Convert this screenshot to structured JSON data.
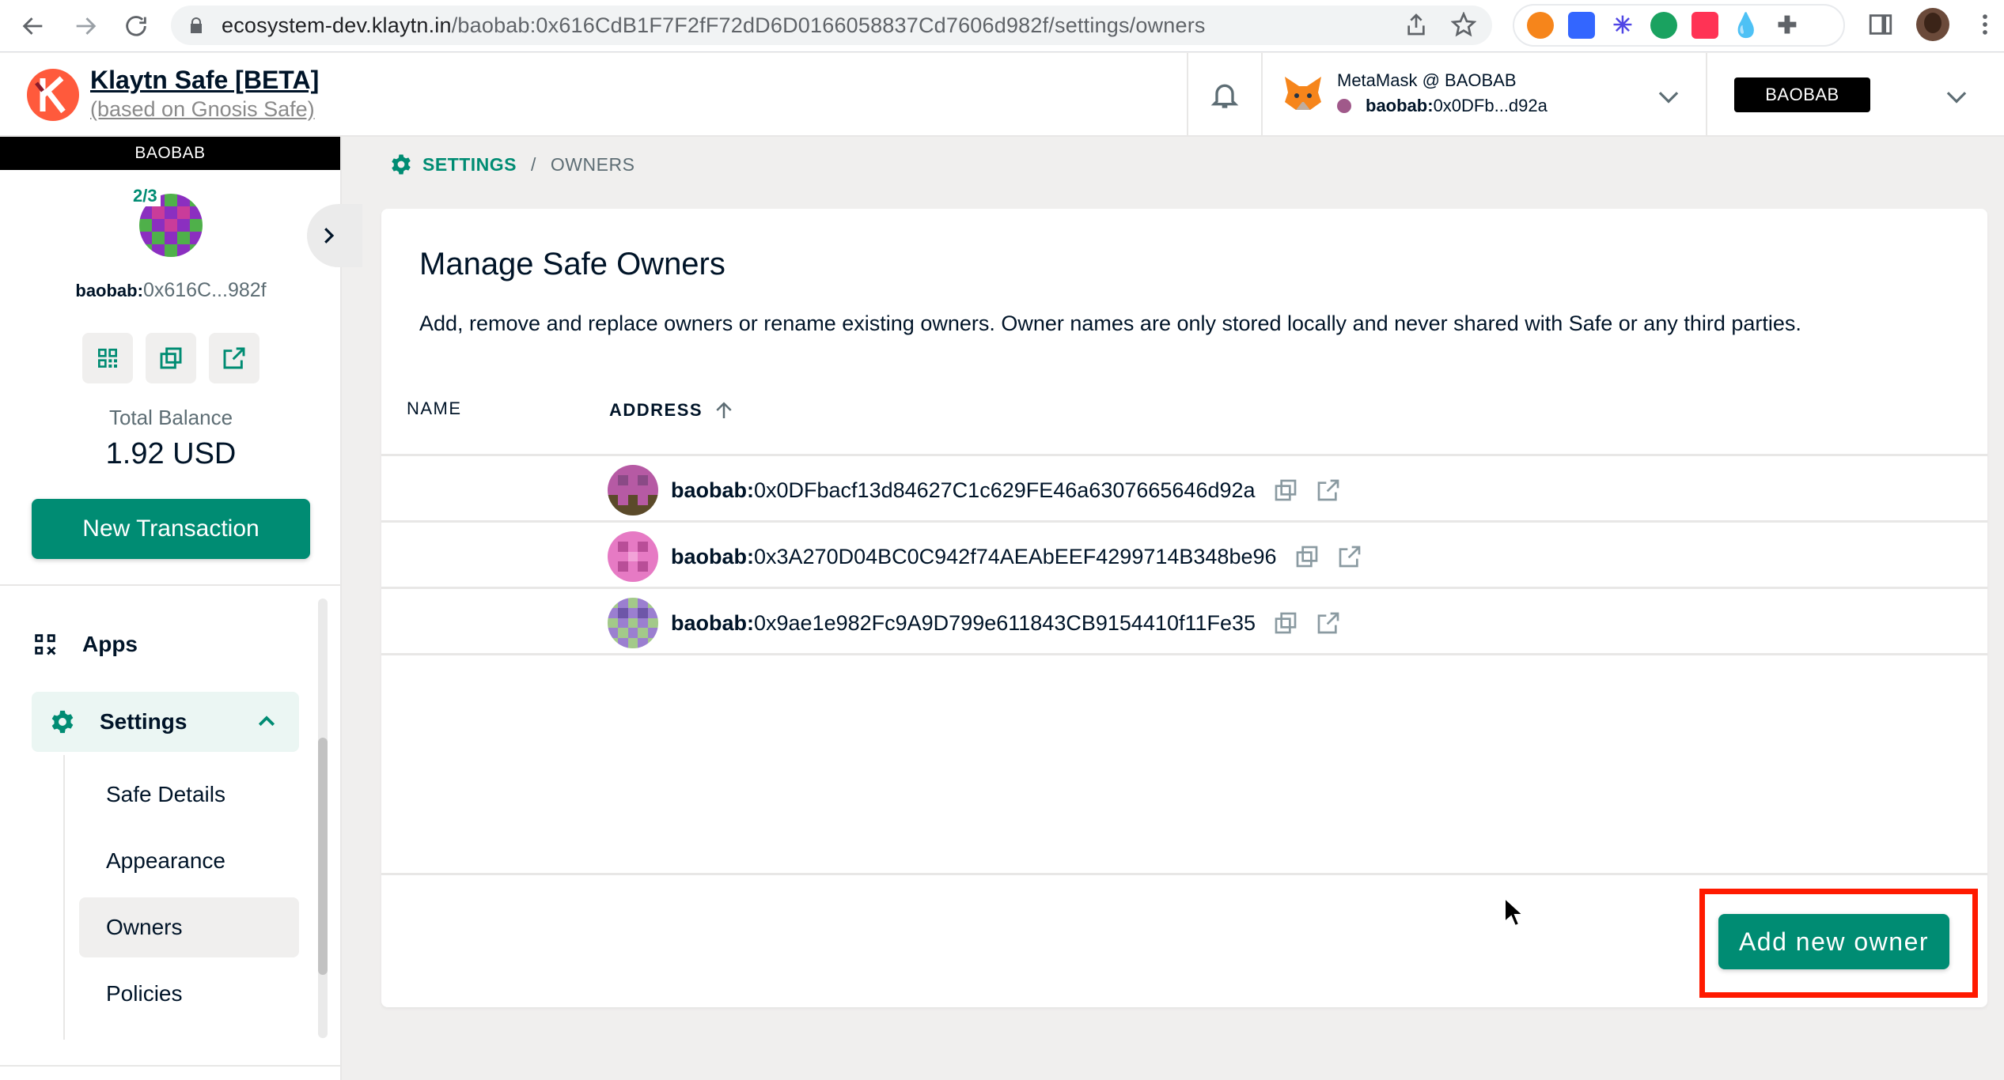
{
  "browser": {
    "url_host": "ecosystem-dev.klaytn.in",
    "url_path": "/baobab:0x616CdB1F7F2fF72dD6D0166058837Cd7606d982f/settings/owners"
  },
  "header": {
    "brand_title": "Klaytn Safe [BETA]",
    "brand_subtitle": "(based on Gnosis Safe)",
    "wallet_name": "MetaMask @ BAOBAB",
    "wallet_prefix": "baobab:",
    "wallet_address": "0x0DFb...d92a",
    "network": "BAOBAB"
  },
  "sidebar": {
    "network_band": "BAOBAB",
    "threshold": "2/3",
    "safe_prefix": "baobab:",
    "safe_address": "0x616C...982f",
    "balance_label": "Total Balance",
    "balance_value": "1.92 USD",
    "new_transaction": "New Transaction",
    "apps_label": "Apps",
    "settings_label": "Settings",
    "subnav": [
      "Safe Details",
      "Appearance",
      "Owners",
      "Policies"
    ]
  },
  "breadcrumb": {
    "section": "SETTINGS",
    "separator": "/",
    "page": "OWNERS"
  },
  "card": {
    "title": "Manage Safe Owners",
    "description": "Add, remove and replace owners or rename existing owners. Owner names are only stored locally and never shared with Safe or any third parties.",
    "col_name": "NAME",
    "col_address": "ADDRESS",
    "owners": [
      {
        "name": "",
        "prefix": "baobab:",
        "address": "0x0DFbacf13d84627C1c629FE46a6307665646d92a"
      },
      {
        "name": "",
        "prefix": "baobab:",
        "address": "0x3A270D04BC0C942f74AEAbEEF4299714B348be96"
      },
      {
        "name": "",
        "prefix": "baobab:",
        "address": "0x9ae1e982Fc9A9D799e611843CB9154410f11Fe35"
      }
    ],
    "add_owner": "Add new owner"
  },
  "colors": {
    "accent": "#008c73",
    "highlight": "#ff1a00",
    "text": "#001428"
  },
  "icons": [
    "back-arrow-icon",
    "forward-arrow-icon",
    "reload-icon",
    "lock-icon",
    "share-icon",
    "star-icon",
    "bell-icon",
    "chevron-down-icon",
    "chevron-right-icon",
    "qr-code-icon",
    "copy-icon",
    "external-link-icon",
    "apps-grid-icon",
    "gear-icon",
    "chevron-up-icon",
    "sort-arrow-up-icon"
  ]
}
